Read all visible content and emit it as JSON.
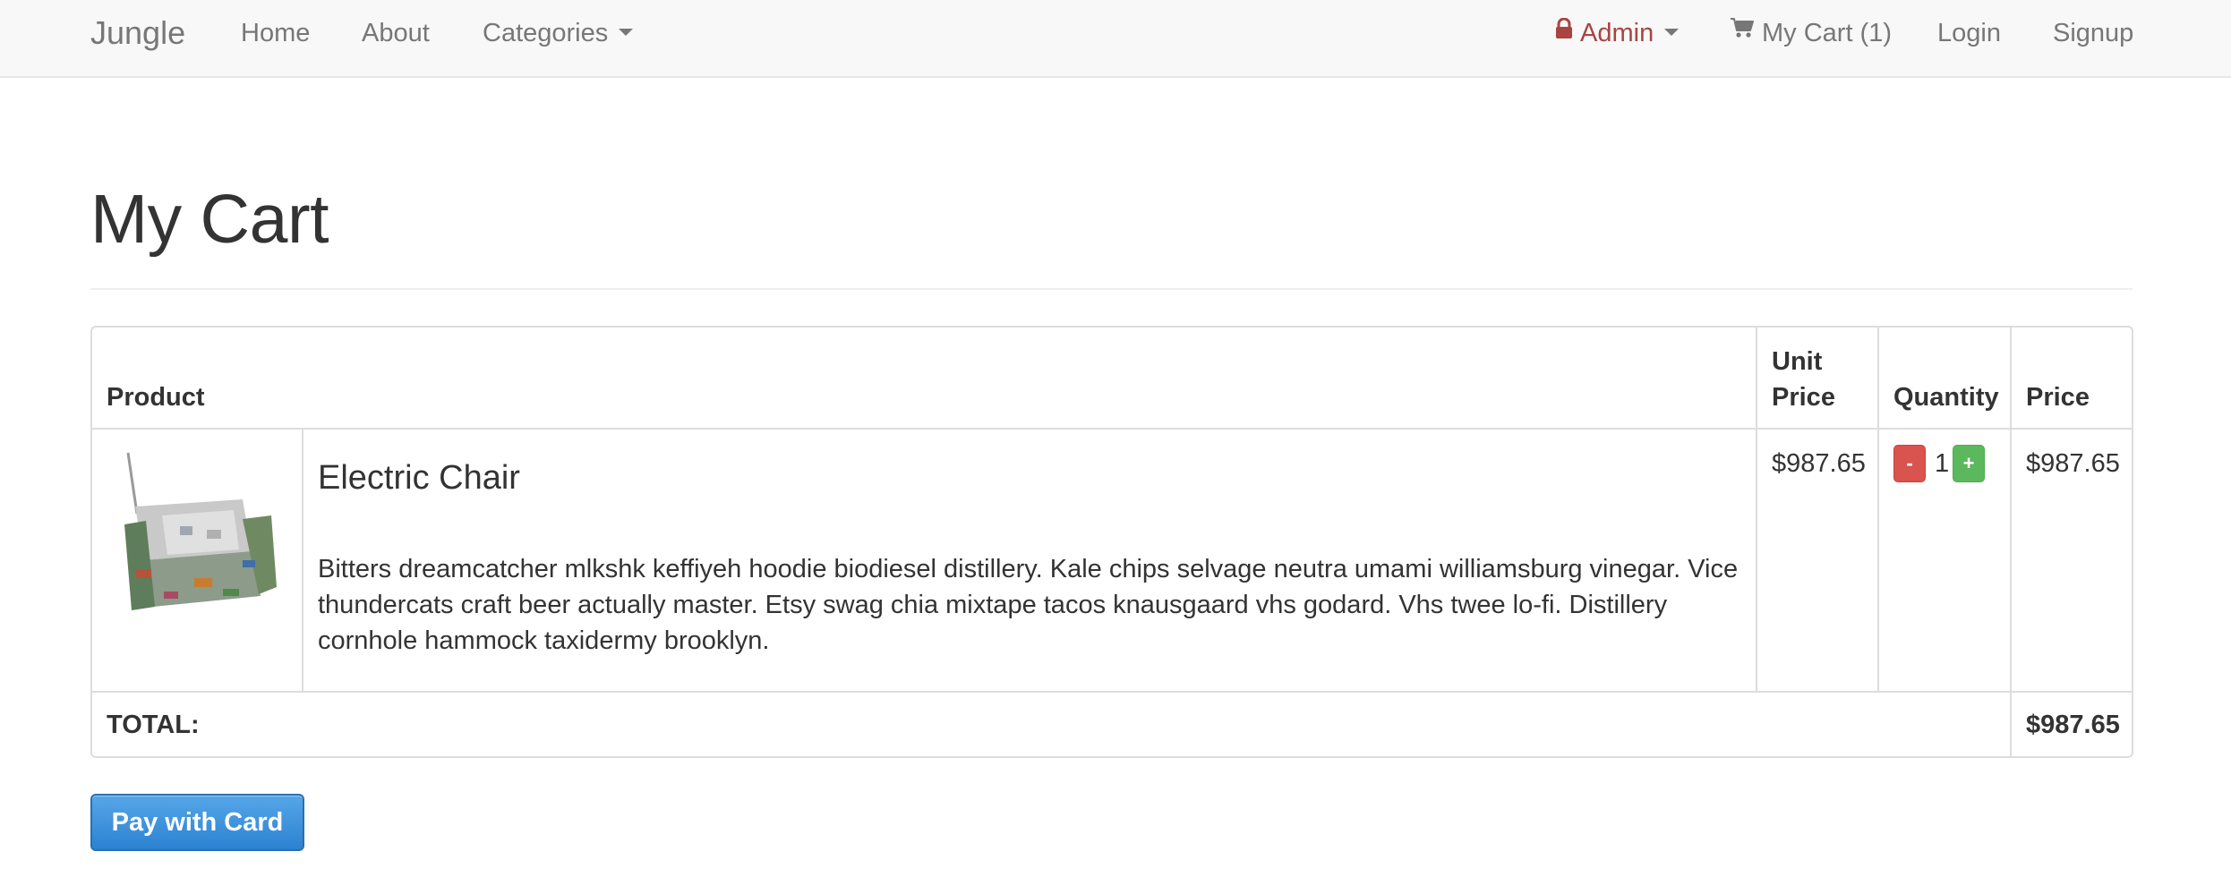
{
  "navbar": {
    "brand": "Jungle",
    "home": "Home",
    "about": "About",
    "categories": "Categories",
    "admin": "Admin",
    "my_cart": "My Cart (1)",
    "login": "Login",
    "signup": "Signup"
  },
  "page": {
    "title": "My Cart"
  },
  "table": {
    "headers": {
      "product": "Product",
      "unit_price_line1": "Unit",
      "unit_price_line2": "Price",
      "quantity": "Quantity",
      "price": "Price"
    },
    "rows": [
      {
        "name": "Electric Chair",
        "description": "Bitters dreamcatcher mlkshk keffiyeh hoodie biodiesel distillery. Kale chips selvage neutra umami williamsburg vinegar. Vice thundercats craft beer actually master. Etsy swag chia mixtape tacos knausgaard vhs godard. Vhs twee lo-fi. Distillery cornhole hammock taxidermy brooklyn.",
        "unit_price": "$987.65",
        "quantity": "1",
        "price": "$987.65",
        "minus_label": "-",
        "plus_label": "+"
      }
    ],
    "total_label": "TOTAL:",
    "total_value": "$987.65"
  },
  "actions": {
    "pay_label": "Pay with Card"
  },
  "colors": {
    "admin": "#a94442",
    "minus_button": "#d9534f",
    "plus_button": "#5cb85c",
    "pay_button": "#3a8fdc"
  },
  "icons": {
    "admin": "lock-icon",
    "cart": "shopping-cart-icon",
    "dropdown": "caret-down-icon"
  }
}
